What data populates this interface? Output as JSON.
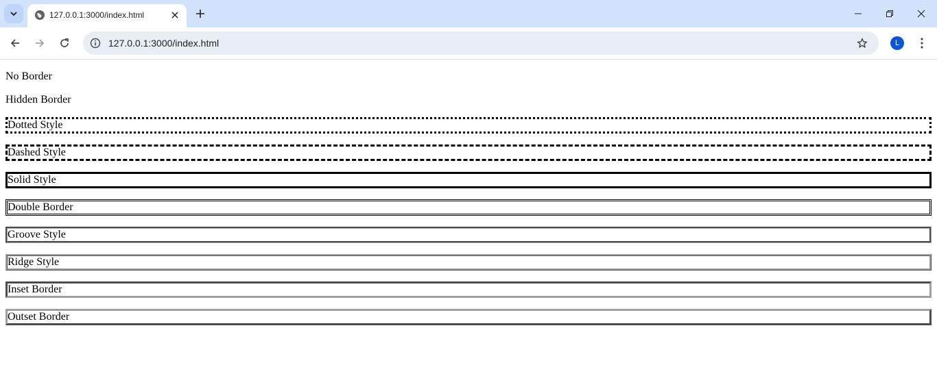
{
  "browser": {
    "tab_title": "127.0.0.1:3000/index.html",
    "url": "127.0.0.1:3000/index.html",
    "profile_initial": "L"
  },
  "paragraphs": {
    "no_border": "No Border",
    "hidden_border": "Hidden Border",
    "dotted": "Dotted Style",
    "dashed": "Dashed Style",
    "solid": "Solid Style",
    "double": "Double Border",
    "groove": "Groove Style",
    "ridge": "Ridge Style",
    "inset": "Inset Border",
    "outset": "Outset Border"
  },
  "colors": {
    "tabstrip": "#d3e3fd",
    "omnibox": "#e9eef6",
    "avatar": "#0b57d0"
  },
  "icons": [
    "tab-search-icon",
    "globe-icon",
    "close-icon",
    "plus-icon",
    "minimize-icon",
    "restore-icon",
    "window-close-icon",
    "back-arrow-icon",
    "forward-arrow-icon",
    "reload-icon",
    "site-info-icon",
    "star-icon",
    "kebab-menu-icon"
  ]
}
